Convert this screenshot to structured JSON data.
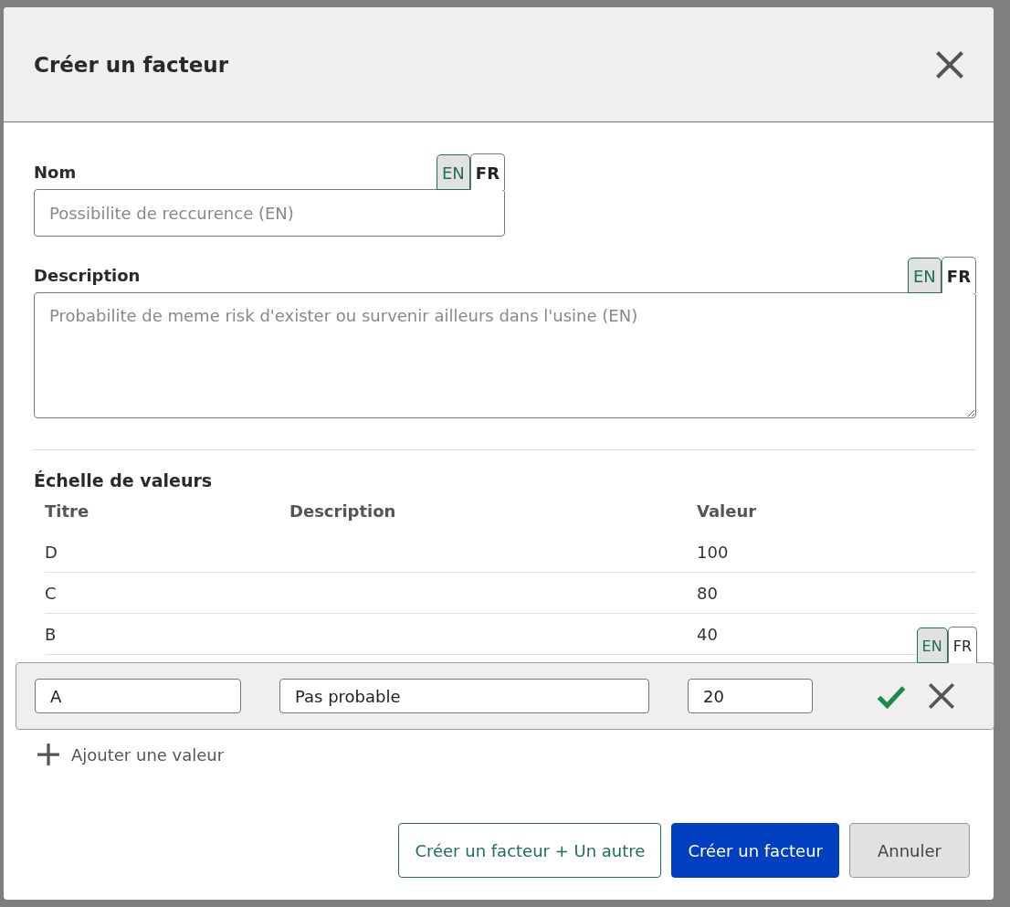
{
  "dialog": {
    "title": "Créer un facteur"
  },
  "name_field": {
    "label": "Nom",
    "placeholder": "Possibilite de reccurence (EN)",
    "languages": [
      {
        "label": "EN",
        "selected": false
      },
      {
        "label": "FR",
        "selected": true
      }
    ]
  },
  "description_field": {
    "label": "Description",
    "placeholder": "Probabilite de meme risk d'exister ou survenir ailleurs dans l'usine (EN)",
    "languages": [
      {
        "label": "EN",
        "selected": false
      },
      {
        "label": "FR",
        "selected": true
      }
    ]
  },
  "scale": {
    "title": "Échelle de valeurs",
    "columns": [
      "Titre",
      "Description",
      "Valeur"
    ],
    "rows": [
      {
        "title": "D",
        "value": "100"
      },
      {
        "title": "C",
        "value": "80"
      },
      {
        "title": "B",
        "value": "40"
      }
    ],
    "edit_row": {
      "title": "A",
      "description": "Pas probable",
      "value": "20",
      "languages": [
        {
          "label": "EN",
          "selected": false
        },
        {
          "label": "FR",
          "selected": true
        }
      ]
    },
    "add_label": "Ajouter une valeur"
  },
  "buttons": [
    {
      "label": "Créer un facteur + Un autre",
      "kind": "outline"
    },
    {
      "label": "Créer un facteur",
      "kind": "primary"
    },
    {
      "label": "Annuler",
      "kind": "secondary"
    }
  ]
}
